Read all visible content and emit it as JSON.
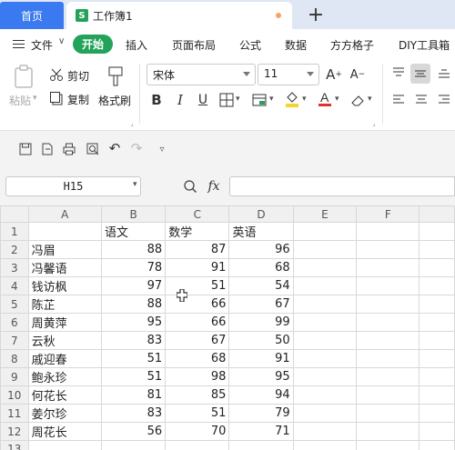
{
  "tabs": {
    "home": "首页",
    "doc_icon": "S",
    "doc_title": "工作簿1",
    "new_tab": "+"
  },
  "menu": {
    "file": "文件",
    "items": [
      "开始",
      "插入",
      "页面布局",
      "公式",
      "数据",
      "方方格子",
      "DIY工具箱"
    ]
  },
  "toolbar": {
    "paste": "粘贴",
    "cut": "剪切",
    "copy": "复制",
    "format_painter": "格式刷",
    "font_name": "宋体",
    "font_size": "11",
    "grow_font": "A",
    "shrink_font": "A",
    "bold": "B",
    "italic": "I",
    "underline": "U"
  },
  "formula_bar": {
    "name_box": "H15",
    "fx": "fx"
  },
  "sheet": {
    "columns": [
      "A",
      "B",
      "C",
      "D",
      "E",
      "F"
    ],
    "rows": [
      {
        "n": "1",
        "a": "",
        "b": "语文",
        "c": "数学",
        "d": "英语"
      },
      {
        "n": "2",
        "a": "冯眉",
        "b": "88",
        "c": "87",
        "d": "96"
      },
      {
        "n": "3",
        "a": "冯馨语",
        "b": "78",
        "c": "91",
        "d": "68"
      },
      {
        "n": "4",
        "a": "钱访枫",
        "b": "97",
        "c": "51",
        "d": "54"
      },
      {
        "n": "5",
        "a": "陈芷",
        "b": "88",
        "c": "66",
        "d": "67"
      },
      {
        "n": "6",
        "a": "周黄萍",
        "b": "95",
        "c": "66",
        "d": "99"
      },
      {
        "n": "7",
        "a": "云秋",
        "b": "83",
        "c": "67",
        "d": "50"
      },
      {
        "n": "8",
        "a": "戚迎春",
        "b": "51",
        "c": "68",
        "d": "91"
      },
      {
        "n": "9",
        "a": "鲍永珍",
        "b": "51",
        "c": "98",
        "d": "95"
      },
      {
        "n": "10",
        "a": "何花长",
        "b": "81",
        "c": "85",
        "d": "94"
      },
      {
        "n": "11",
        "a": "姜尔珍",
        "b": "83",
        "c": "51",
        "d": "79"
      },
      {
        "n": "12",
        "a": "周花长",
        "b": "56",
        "c": "70",
        "d": "71"
      },
      {
        "n": "13",
        "a": "",
        "b": "",
        "c": "",
        "d": ""
      }
    ]
  },
  "colors": {
    "home_tab": "#3a79ef",
    "active_menu": "#23a35a",
    "doc_icon": "#23a35a",
    "unsaved_dot": "#f5a36b"
  }
}
